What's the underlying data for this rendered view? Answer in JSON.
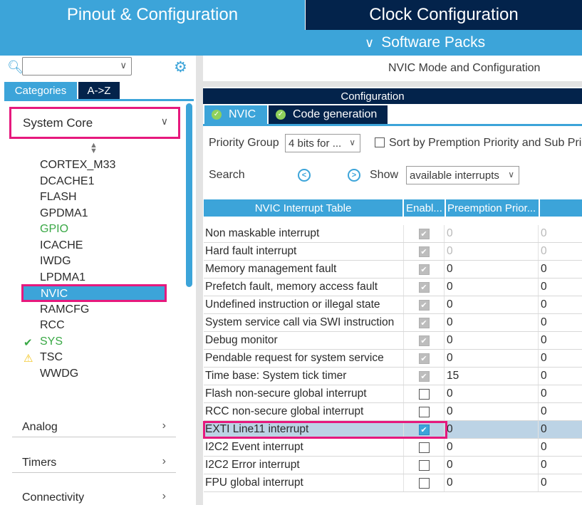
{
  "top_tabs": {
    "pinout": "Pinout & Configuration",
    "clock": "Clock Configuration"
  },
  "software_packs": {
    "label": "Software Packs"
  },
  "left": {
    "category_tabs": {
      "categories": "Categories",
      "az": "A->Z"
    },
    "section": "System Core",
    "peripherals": [
      {
        "label": "CORTEX_M33",
        "status": ""
      },
      {
        "label": "DCACHE1",
        "status": ""
      },
      {
        "label": "FLASH",
        "status": ""
      },
      {
        "label": "GPDMA1",
        "status": ""
      },
      {
        "label": "GPIO",
        "status": "configured"
      },
      {
        "label": "ICACHE",
        "status": ""
      },
      {
        "label": "IWDG",
        "status": ""
      },
      {
        "label": "LPDMA1",
        "status": ""
      },
      {
        "label": "NVIC",
        "status": "selected"
      },
      {
        "label": "RAMCFG",
        "status": ""
      },
      {
        "label": "RCC",
        "status": ""
      },
      {
        "label": "SYS",
        "status": "ok"
      },
      {
        "label": "TSC",
        "status": "warning"
      },
      {
        "label": "WWDG",
        "status": ""
      }
    ],
    "categories": [
      "Analog",
      "Timers",
      "Connectivity"
    ]
  },
  "right": {
    "mode_title": "NVIC Mode and Configuration",
    "config_title": "Configuration",
    "tabs": {
      "nvic": "NVIC",
      "code_generation": "Code generation"
    },
    "priority_group_label": "Priority Group",
    "priority_group_value": "4 bits for ...",
    "sort_label": "Sort by Premption Priority and Sub Priority",
    "search_label": "Search",
    "show_label": "Show",
    "show_value": "available interrupts",
    "table": {
      "headers": {
        "name": "NVIC Interrupt Table",
        "enabled": "Enabl...",
        "preemption": "Preemption Prior..."
      },
      "rows": [
        {
          "name": "Non maskable interrupt",
          "enabled": true,
          "locked": true,
          "pre": "0",
          "sub": "0"
        },
        {
          "name": "Hard fault interrupt",
          "enabled": true,
          "locked": true,
          "pre": "0",
          "sub": "0"
        },
        {
          "name": "Memory management fault",
          "enabled": true,
          "locked": true,
          "pre": "0",
          "sub": "0"
        },
        {
          "name": "Prefetch fault, memory access fault",
          "enabled": true,
          "locked": true,
          "pre": "0",
          "sub": "0"
        },
        {
          "name": "Undefined instruction or illegal state",
          "enabled": true,
          "locked": true,
          "pre": "0",
          "sub": "0"
        },
        {
          "name": "System service call via SWI instruction",
          "enabled": true,
          "locked": true,
          "pre": "0",
          "sub": "0"
        },
        {
          "name": "Debug monitor",
          "enabled": true,
          "locked": true,
          "pre": "0",
          "sub": "0"
        },
        {
          "name": "Pendable request for system service",
          "enabled": true,
          "locked": true,
          "pre": "0",
          "sub": "0"
        },
        {
          "name": "Time base: System tick timer",
          "enabled": true,
          "locked": true,
          "pre": "15",
          "sub": "0"
        },
        {
          "name": "Flash non-secure global interrupt",
          "enabled": false,
          "locked": false,
          "pre": "0",
          "sub": "0"
        },
        {
          "name": "RCC non-secure global interrupt",
          "enabled": false,
          "locked": false,
          "pre": "0",
          "sub": "0"
        },
        {
          "name": "EXTI Line11 interrupt",
          "enabled": true,
          "locked": false,
          "pre": "0",
          "sub": "0"
        },
        {
          "name": "I2C2 Event interrupt",
          "enabled": false,
          "locked": false,
          "pre": "0",
          "sub": "0"
        },
        {
          "name": "I2C2 Error interrupt",
          "enabled": false,
          "locked": false,
          "pre": "0",
          "sub": "0"
        },
        {
          "name": "FPU global interrupt",
          "enabled": false,
          "locked": false,
          "pre": "0",
          "sub": "0"
        }
      ]
    }
  },
  "colors": {
    "accent": "#3ca4d9",
    "dark": "#03234b",
    "highlight": "#e6197d",
    "ok": "#39a845",
    "warn": "#f2c318"
  }
}
